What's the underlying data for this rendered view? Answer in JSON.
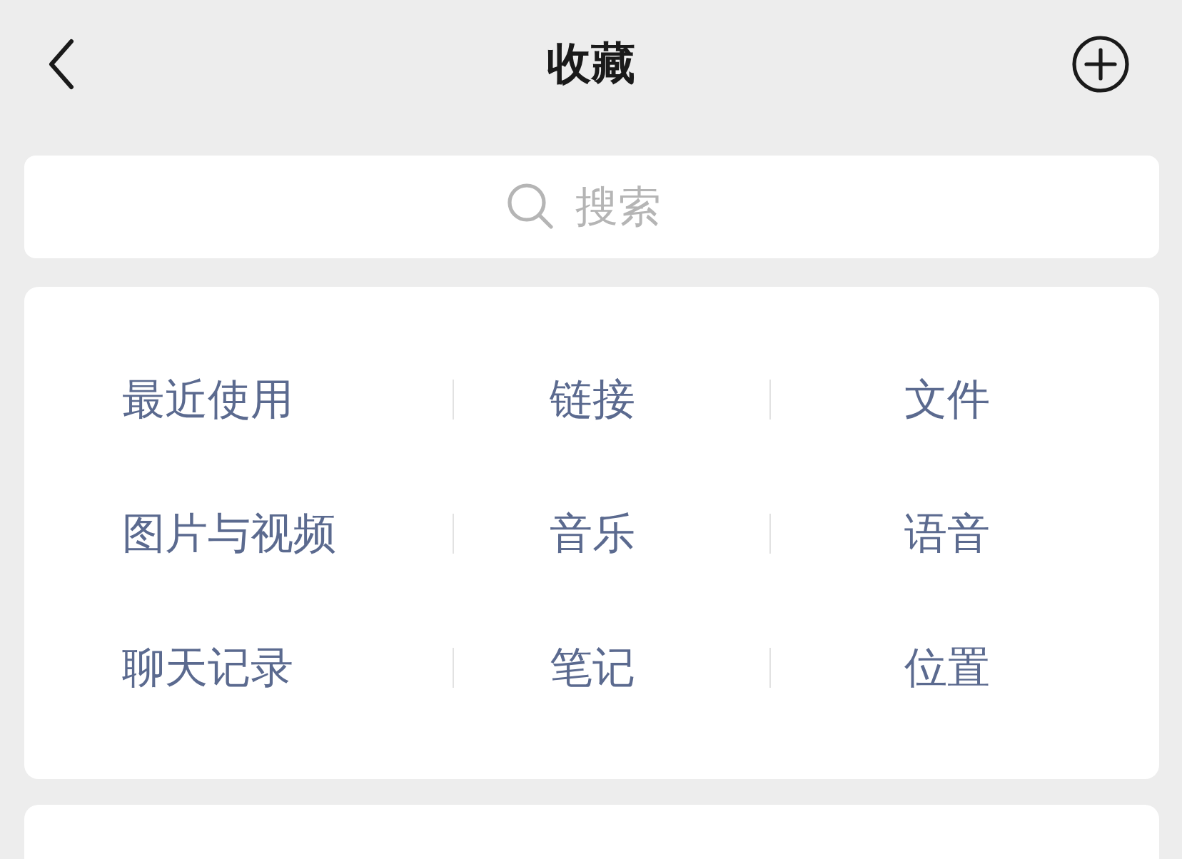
{
  "header": {
    "title": "收藏"
  },
  "search": {
    "placeholder": "搜索"
  },
  "categories": [
    [
      "最近使用",
      "链接",
      "文件"
    ],
    [
      "图片与视频",
      "音乐",
      "语音"
    ],
    [
      "聊天记录",
      "笔记",
      "位置"
    ]
  ]
}
